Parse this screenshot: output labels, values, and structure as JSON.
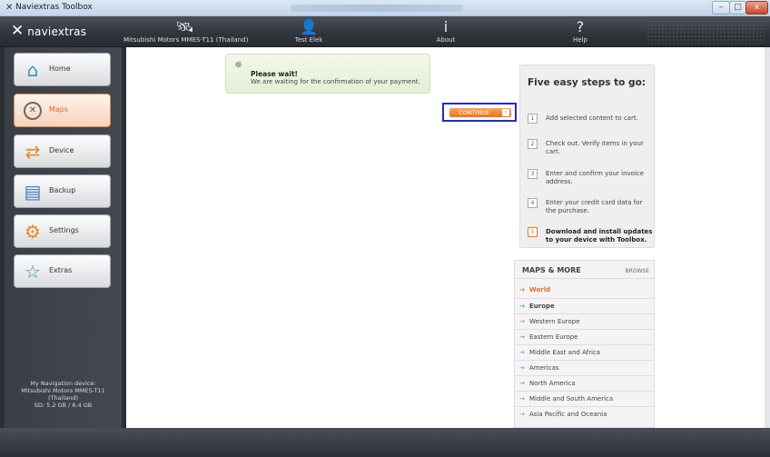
{
  "window": {
    "icon": "naviextras-x-icon",
    "title": "Naviextras Toolbox",
    "min_glyph": "–",
    "max_glyph": "□",
    "close_glyph": "x"
  },
  "app": {
    "logo_glyph": "✕",
    "logo_text": "naviextras"
  },
  "topnav": {
    "device": {
      "label": "Mitsubishi Motors MMES-T11 (Thailand)",
      "icon": "satellite-icon",
      "glyph": "🛰"
    },
    "test": {
      "label": "Test Elek",
      "icon": "user-icon",
      "glyph": "👤"
    },
    "about": {
      "label": "About",
      "icon": "info-icon",
      "glyph": "i"
    },
    "help": {
      "label": "Help",
      "icon": "help-icon",
      "glyph": "?"
    }
  },
  "sidebar": {
    "items": [
      {
        "label": "Home",
        "icon": "home-icon",
        "glyph": "⌂"
      },
      {
        "label": "Maps",
        "icon": "compass-icon",
        "glyph": "✕",
        "active": true
      },
      {
        "label": "Device",
        "icon": "device-sync-icon",
        "glyph": "⇄"
      },
      {
        "label": "Backup",
        "icon": "backup-icon",
        "glyph": "▤"
      },
      {
        "label": "Settings",
        "icon": "gears-icon",
        "glyph": "⚙"
      },
      {
        "label": "Extras",
        "icon": "star-icon",
        "glyph": "☆"
      }
    ],
    "device_info": {
      "line1": "My Navigation device:",
      "line2": "Mitsubishi Motors MMES-T11",
      "line3": "(Thailand)",
      "line4": "SD: 5.2 GB / 6.4 GB"
    }
  },
  "wait": {
    "spinner_glyph": "✵",
    "title": "Please wait!",
    "message": "We are waiting for the confirmation of your payment."
  },
  "continue": {
    "label": "CONTINUE",
    "arrow_glyph": "›"
  },
  "steps": {
    "title": "Five easy steps to go:",
    "items": [
      {
        "num": "1",
        "text": "Add selected content to cart."
      },
      {
        "num": "2",
        "text": "Check out. Verify items in your cart."
      },
      {
        "num": "3",
        "text": "Enter and confirm your invoice address."
      },
      {
        "num": "4",
        "text": "Enter your credit card data for the purchase."
      },
      {
        "num": "5",
        "text": "Download and install updates to your device with Toolbox."
      }
    ]
  },
  "maps_more": {
    "title": "MAPS & MORE",
    "browse": "BROWSE",
    "arrow_glyph": "→",
    "items": [
      "World",
      "Europe",
      "Western Europe",
      "Eastern Europe",
      "Middle East and Africa",
      "Americas",
      "North America",
      "Middle and South America",
      "Asia Pacific and Oceania"
    ]
  },
  "colors": {
    "accent": "#e8761f",
    "link_arrow": "#3f9ad0",
    "highlight_box": "#1e2dc8"
  }
}
